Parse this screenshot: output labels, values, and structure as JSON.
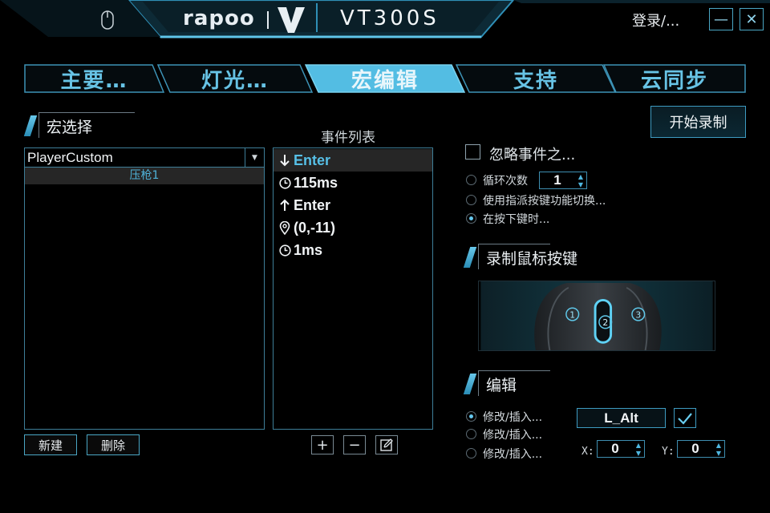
{
  "header": {
    "brand": "rapoo",
    "model": "VT300S",
    "login": "登录/...",
    "minimize": "—",
    "close": "✕"
  },
  "tabs": [
    {
      "label": "主要…",
      "active": false
    },
    {
      "label": "灯光…",
      "active": false
    },
    {
      "label": "宏编辑",
      "active": true
    },
    {
      "label": "支持",
      "active": false
    },
    {
      "label": "云同步",
      "active": false
    }
  ],
  "macro": {
    "section_title": "宏选择",
    "selected_profile": "PlayerCustom",
    "items": [
      "压枪1"
    ],
    "new_label": "新建",
    "delete_label": "删除"
  },
  "events": {
    "title": "事件列表",
    "rows": [
      {
        "icon": "key-down-arrow-icon",
        "text": "Enter"
      },
      {
        "icon": "clock-icon",
        "text": "115ms"
      },
      {
        "icon": "key-up-arrow-icon",
        "text": "Enter"
      },
      {
        "icon": "location-pin-icon",
        "text": "(0,-11)"
      },
      {
        "icon": "clock-icon",
        "text": "1ms"
      }
    ],
    "add_label": "+",
    "remove_label": "−"
  },
  "options": {
    "record_button": "开始录制",
    "ignore_events": "忽略事件之...",
    "loop_count_label": "循环次数",
    "loop_count": "1",
    "toggle_by_key": "使用指派按键功能切换...",
    "while_pressed": "在按下键时...",
    "selected_mode": "while_pressed"
  },
  "record_mouse": {
    "section_title": "录制鼠标按键",
    "buttons": [
      "1",
      "2",
      "3"
    ]
  },
  "edit": {
    "section_title": "编辑",
    "options": [
      "修改/插入...",
      "修改/插入...",
      "修改/插入..."
    ],
    "selected_index": 0,
    "key_value": "L_Alt",
    "x_label": "X:",
    "x_value": "0",
    "y_label": "Y:",
    "y_value": "0"
  },
  "colors": {
    "accent": "#56bfe6",
    "border": "#3e7e98",
    "background": "#000000"
  }
}
